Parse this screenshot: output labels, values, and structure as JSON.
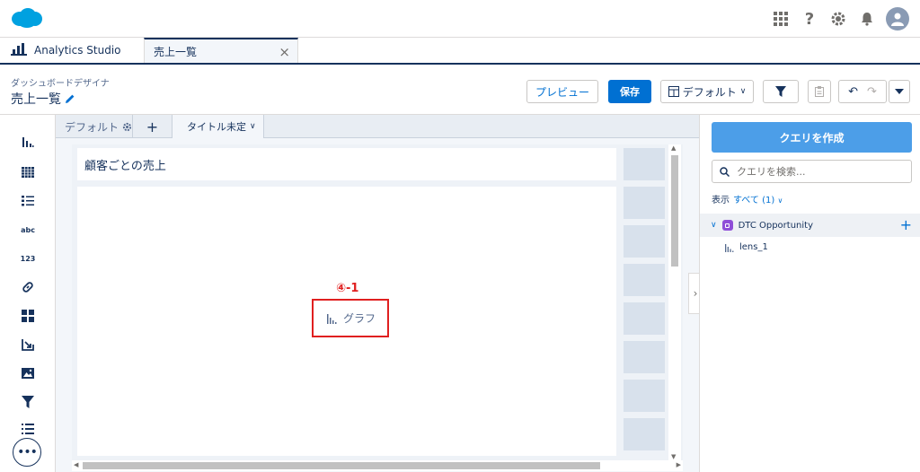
{
  "header": {
    "icons": [
      "apps-grid-icon",
      "help-icon",
      "setup-gear-icon",
      "notifications-bell-icon",
      "user-avatar-icon"
    ]
  },
  "tabs": {
    "app_label": "Analytics Studio",
    "doc_label": "売上一覧",
    "close_glyph": "×"
  },
  "designer": {
    "subtitle": "ダッシュボードデザイナ",
    "title": "売上一覧",
    "preview_label": "プレビュー",
    "save_label": "保存",
    "layout_label": "デフォルト"
  },
  "layout_tabs": {
    "default_label": "デフォルト",
    "add_glyph": "+",
    "page_label": "タイトル未定"
  },
  "canvas": {
    "title_widget_text": "顧客ごとの売上",
    "chart_placeholder": "グラフ",
    "annotation": "④-1"
  },
  "right_panel": {
    "create_query_label": "クエリを作成",
    "search_placeholder": "クエリを検索...",
    "show_label": "表示",
    "filter_label": "すべて (1)",
    "dataset_name": "DTC Opportunity",
    "lens_name": "lens_1"
  },
  "rail": {
    "text_item": "abc",
    "number_item": "123",
    "more_glyph": "•••"
  },
  "colors": {
    "brand_blue": "#0070d2",
    "create_button": "#4c9ee8",
    "dataset_badge": "#8f4ed8",
    "annotation_red": "#e02020"
  }
}
